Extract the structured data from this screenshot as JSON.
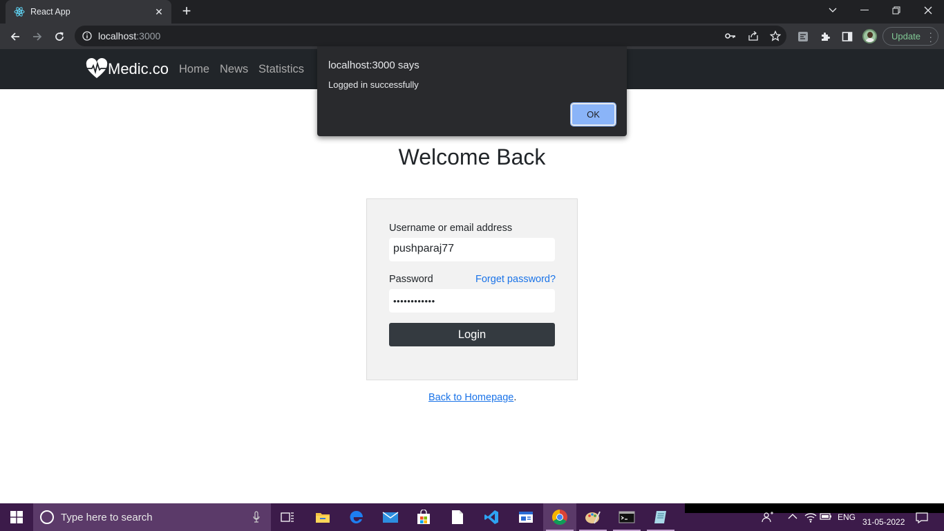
{
  "browser": {
    "tab_title": "React App",
    "url_host": "localhost",
    "url_port": ":3000",
    "update_label": "Update",
    "accent_update": "#81c995"
  },
  "site": {
    "brand": "Medic.co",
    "nav": [
      "Home",
      "News",
      "Statistics"
    ]
  },
  "page": {
    "title": "Welcome Back",
    "username_label": "Username or email address",
    "username_value": "pushparaj77",
    "password_label": "Password",
    "password_value": "••••••••••••",
    "forgot_label": "Forget password?",
    "login_label": "Login",
    "back_link": "Back to Homepage",
    "back_suffix": "."
  },
  "dialog": {
    "title": "localhost:3000 says",
    "message": "Logged in successfully",
    "ok_label": "OK"
  },
  "taskbar": {
    "search_placeholder": "Type here to search",
    "language": "ENG",
    "date": "31-05-2022"
  }
}
